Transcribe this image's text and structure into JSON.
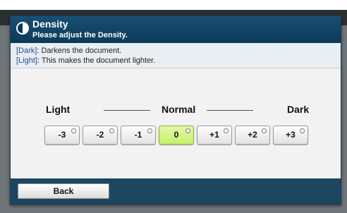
{
  "header": {
    "title": "Density",
    "subtitle": "Please adjust the Density."
  },
  "info": {
    "dark_tag": "[Dark]",
    "dark_text": ": Darkens the document.",
    "light_tag": "[Light]",
    "light_text": ": This makes the document lighter."
  },
  "scale": {
    "light": "Light",
    "normal": "Normal",
    "dark": "Dark"
  },
  "density_options": [
    {
      "label": "-3",
      "selected": false
    },
    {
      "label": "-2",
      "selected": false
    },
    {
      "label": "-1",
      "selected": false
    },
    {
      "label": "0",
      "selected": true
    },
    {
      "label": "+1",
      "selected": false
    },
    {
      "label": "+2",
      "selected": false
    },
    {
      "label": "+3",
      "selected": false
    }
  ],
  "footer": {
    "back_label": "Back"
  },
  "colors": {
    "header": "#0c3a59",
    "selected": "#c7ef6c",
    "footer": "#1d4660"
  }
}
